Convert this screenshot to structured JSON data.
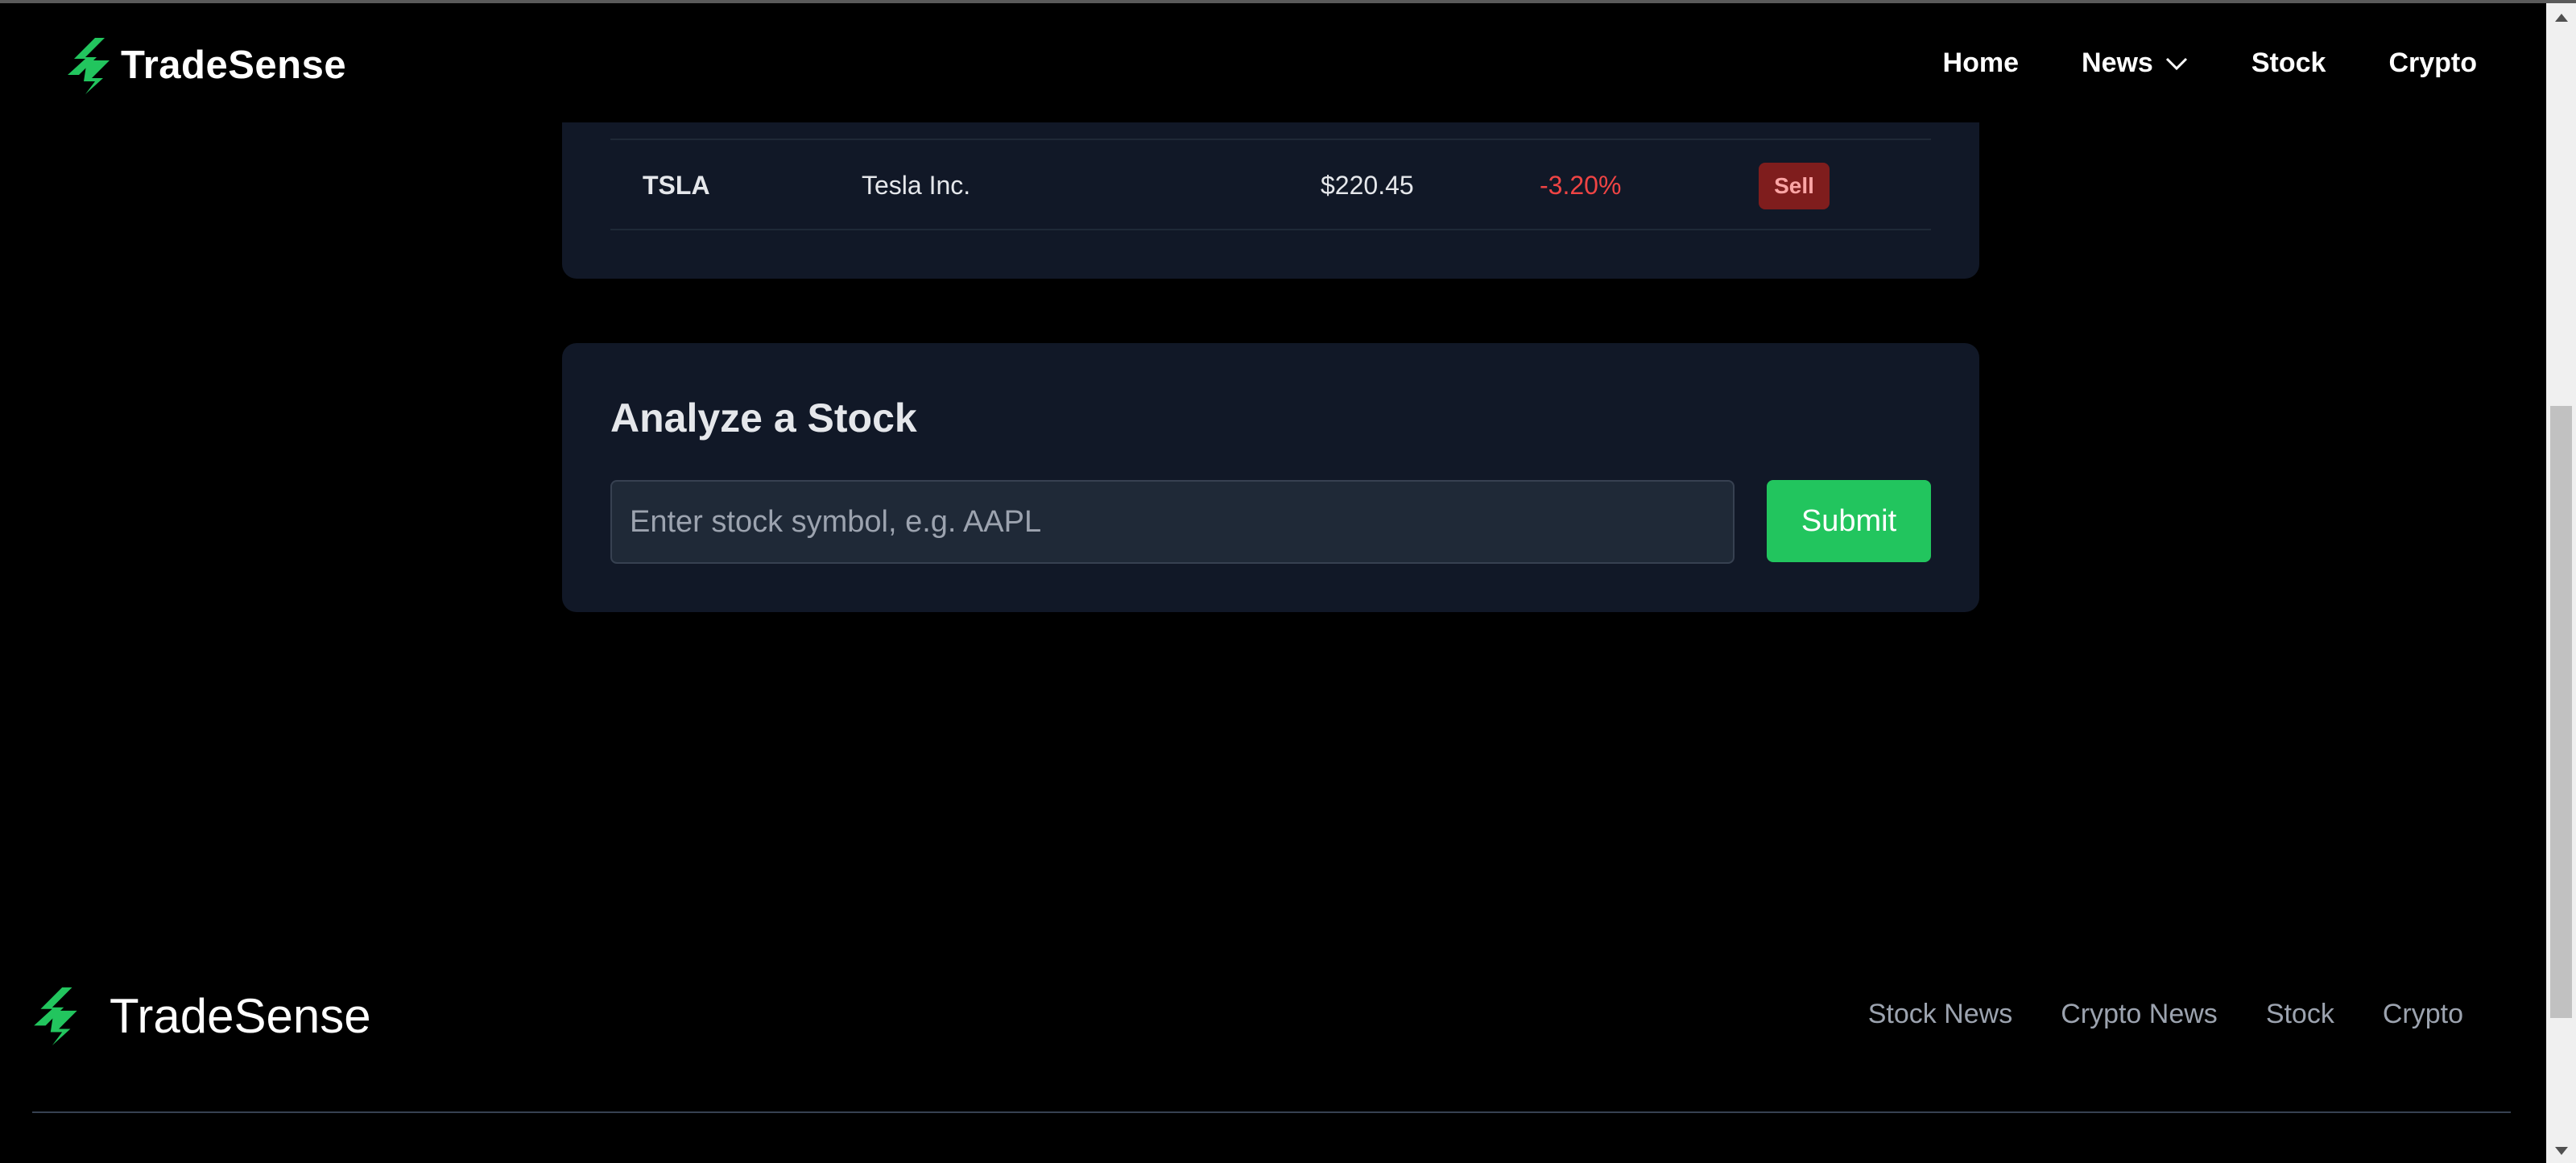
{
  "brand": {
    "name": "TradeSense",
    "logo_icon": "tradesense-logo-icon",
    "accent_color": "#22c55e"
  },
  "nav": {
    "home": "Home",
    "news": "News",
    "stock": "Stock",
    "crypto": "Crypto"
  },
  "table": {
    "rows": [
      {
        "symbol": "TSLA",
        "company": "Tesla Inc.",
        "price": "$220.45",
        "change": "-3.20%",
        "signal": "Sell"
      }
    ]
  },
  "analyze": {
    "title": "Analyze a Stock",
    "input_placeholder": "Enter stock symbol, e.g. AAPL",
    "input_value": "",
    "submit_label": "Submit"
  },
  "footer": {
    "brand_name": "TradeSense",
    "links": [
      "Stock News",
      "Crypto News",
      "Stock",
      "Crypto"
    ]
  },
  "colors": {
    "background": "#000000",
    "card": "#111827",
    "negative": "#ef4444",
    "sell_badge": "#7f1d1d"
  }
}
